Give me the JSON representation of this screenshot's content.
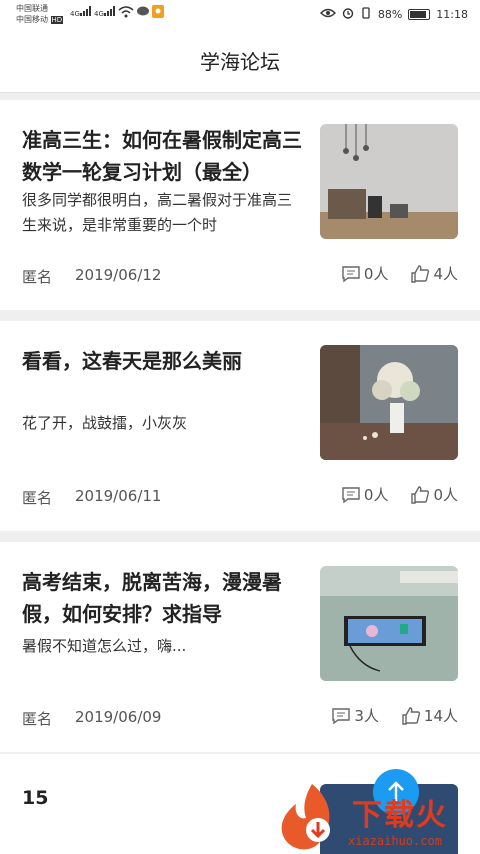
{
  "status_bar": {
    "carrier1": "中国联通",
    "carrier2": "中国移动",
    "hd": "HD",
    "net1": "4G",
    "net2": "4G",
    "battery_pct": "88%",
    "time": "11:18"
  },
  "header": {
    "title": "学海论坛"
  },
  "posts": [
    {
      "title": "准高三生：如何在暑假制定高三数学一轮复习计划（最全）",
      "desc": "很多同学都很明白，高二暑假对于准高三生来说，是非常重要的一个时",
      "author": "匿名",
      "date": "2019/06/12",
      "comments": "0人",
      "likes": "4人",
      "thumb": "room-interior-image"
    },
    {
      "title": "看看，这春天是那么美丽",
      "desc": "花了开，战鼓擂，小灰灰",
      "author": "匿名",
      "date": "2019/06/11",
      "comments": "0人",
      "likes": "0人",
      "thumb": "flower-vase-image"
    },
    {
      "title": "高考结束，脱离苦海，漫漫暑假，如何安排？求指导",
      "desc": "暑假不知道怎么过，嗨...",
      "author": "匿名",
      "date": "2019/06/09",
      "comments": "3人",
      "likes": "14人",
      "thumb": "tablet-on-desk-image"
    }
  ],
  "partial_post": {
    "number": "15"
  },
  "watermark": {
    "text": "下载火",
    "url": "xiazaihuo.com"
  },
  "colors": {
    "accent": "#1b9cf2",
    "watermark": "#e23a1d"
  }
}
